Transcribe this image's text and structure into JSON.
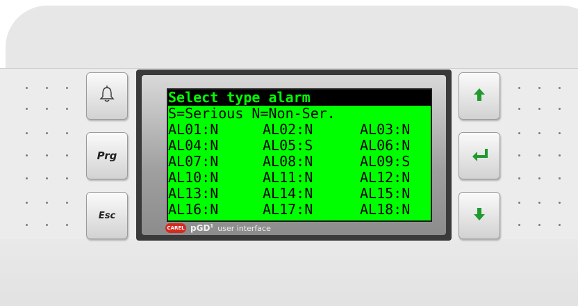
{
  "lcd": {
    "title": "Select type alarm",
    "legend": "S=Serious N=Non-Ser.",
    "rows": [
      [
        "AL01:N",
        "AL02:N",
        "AL03:N"
      ],
      [
        "AL04:N",
        "AL05:S",
        "AL06:N"
      ],
      [
        "AL07:N",
        "AL08:N",
        "AL09:S"
      ],
      [
        "AL10:N",
        "AL11:N",
        "AL12:N"
      ],
      [
        "AL13:N",
        "AL14:N",
        "AL15:N"
      ],
      [
        "AL16:N",
        "AL17:N",
        "AL18:N"
      ]
    ]
  },
  "buttons": {
    "alarm_icon": "bell-icon",
    "prg_label": "Prg",
    "esc_label": "Esc",
    "up_icon": "arrow-up-icon",
    "enter_icon": "enter-icon",
    "down_icon": "arrow-down-icon"
  },
  "brand": {
    "logo_text": "CAREL",
    "product": "pGD",
    "superscript": "1",
    "subtitle": "user interface"
  },
  "colors": {
    "lcd_background": "#00ff00",
    "lcd_text": "#000000",
    "arrow_green": "#1f9a2f",
    "logo_red": "#d52a1f"
  }
}
